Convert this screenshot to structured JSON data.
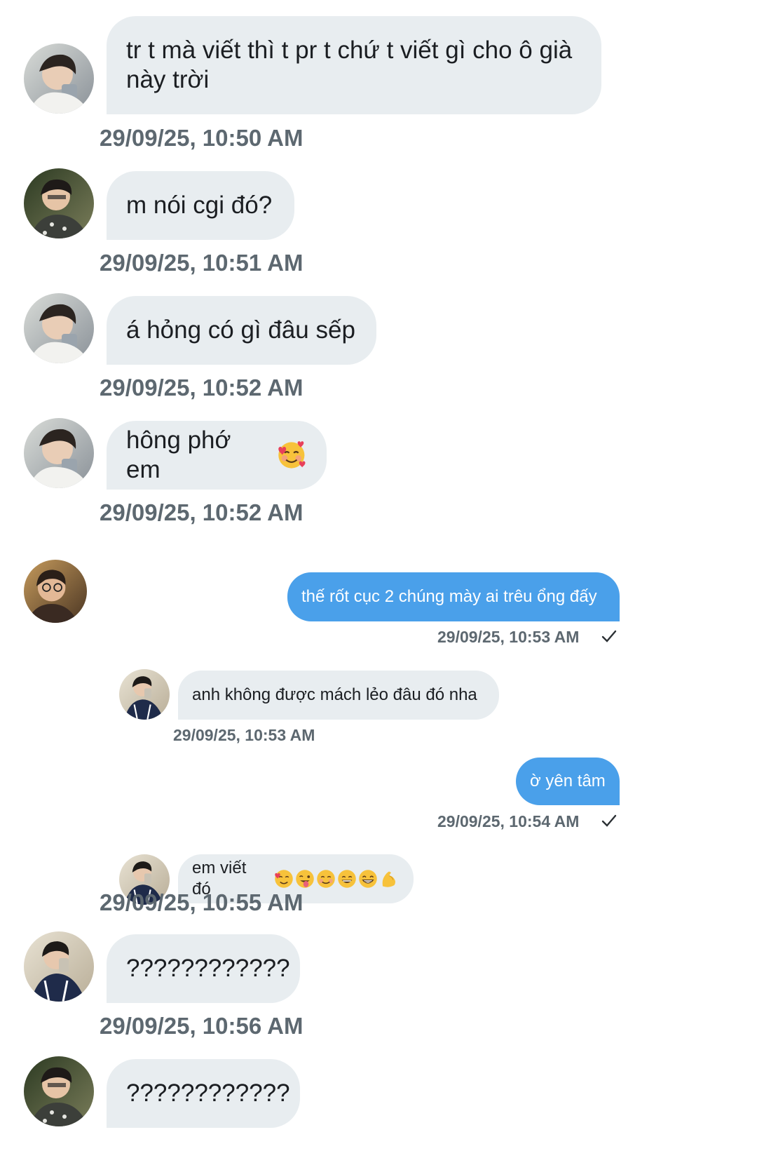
{
  "messages": [
    {
      "text": "tr t mà viết thì t pr t chứ t viết gì cho ô già này trời",
      "time": "29/09/25, 10:50 AM"
    },
    {
      "text": "m nói cgi đó?",
      "time": "29/09/25, 10:51 AM"
    },
    {
      "text": "á hỏng có gì đâu sếp",
      "time": "29/09/25, 10:52 AM"
    },
    {
      "text": "hông phớ em",
      "time": "29/09/25, 10:52 AM"
    },
    {
      "text": "thế rốt cục 2 chúng mày ai trêu ổng đấy",
      "time": "29/09/25, 10:53 AM"
    },
    {
      "text": "anh không được mách lẻo đâu đó nha",
      "time": "29/09/25, 10:53 AM"
    },
    {
      "text": "ờ yên tâm",
      "time": "29/09/25, 10:54 AM"
    },
    {
      "text": "em viết đó",
      "time": "29/09/25, 10:55 AM"
    },
    {
      "text": "????????????",
      "time": "29/09/25, 10:56 AM"
    },
    {
      "text": "????????????"
    }
  ],
  "icons": {
    "smile_hearts": "smiling-face-with-hearts-icon",
    "tongue": "winking-face-tongue-icon",
    "blush": "smiling-face-icon",
    "grin": "grinning-face-icon",
    "beam": "beaming-face-icon",
    "muscle": "flexed-biceps-icon",
    "check": "checkmark-icon"
  },
  "colors": {
    "incoming_bubble": "#e8edf0",
    "outgoing_bubble": "#4aa0ea",
    "timestamp": "#5d6870"
  }
}
